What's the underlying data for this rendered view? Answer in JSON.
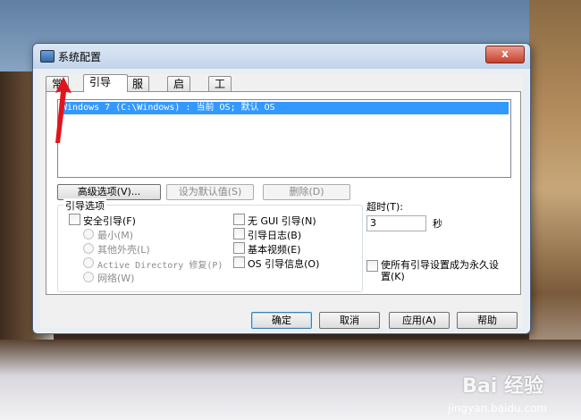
{
  "window": {
    "title": "系统配置",
    "close_symbol": "x",
    "tabs": [
      {
        "label": "常规"
      },
      {
        "label": "引导"
      },
      {
        "label": "服务"
      },
      {
        "label": "启动"
      },
      {
        "label": "工具"
      }
    ],
    "boot": {
      "os_entries": [
        "Windows 7 (C:\\Windows) : 当前 OS; 默认 OS"
      ],
      "advanced_button": "高级选项(V)...",
      "set_default_button": "设为默认值(S)",
      "delete_button": "删除(D)",
      "boot_options": {
        "label": "引导选项",
        "safe_boot": "安全引导(F)",
        "minimal": "最小(M)",
        "alternate_shell": "其他外壳(L)",
        "ad_repair": "Active Directory 修复(P)",
        "network": "网络(W)",
        "no_gui_boot": "无 GUI 引导(N)",
        "boot_log": "引导日志(B)",
        "base_video": "基本视频(E)",
        "os_boot_info": "OS 引导信息(O)"
      },
      "timeout": {
        "label": "超时(T):",
        "value": "3",
        "unit": "秒"
      },
      "make_permanent": "使所有引导设置成为永久设置(K)"
    },
    "buttons": {
      "ok": "确定",
      "cancel": "取消",
      "apply": "应用(A)",
      "help": "帮助"
    }
  },
  "watermark": {
    "brand": "Bai 经验",
    "url": "jingyan.baidu.com"
  },
  "colors": {
    "selection": "#3399ff",
    "annotation_arrow": "#e0141e"
  }
}
